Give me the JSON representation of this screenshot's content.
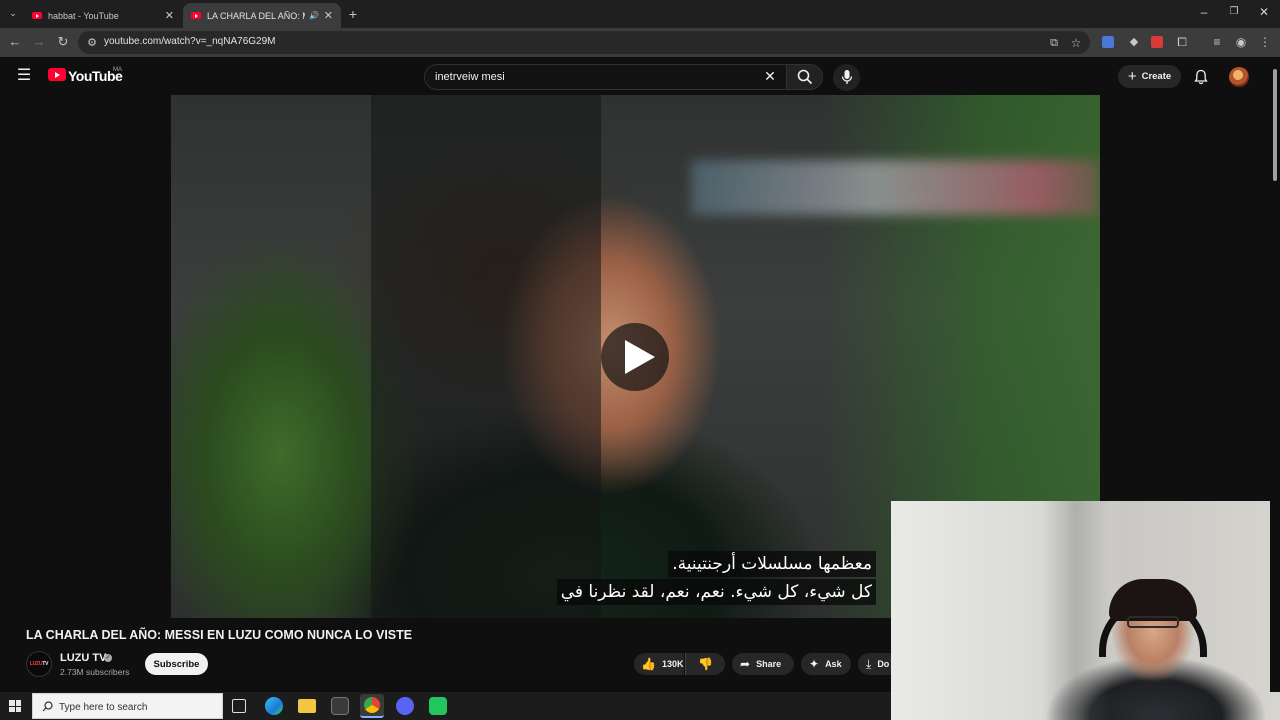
{
  "browser": {
    "tabs": [
      {
        "title": "habbat - YouTube"
      },
      {
        "title": "LA CHARLA DEL AÑO: MESS"
      }
    ],
    "url": "youtube.com/watch?v=_nqNA76G29M"
  },
  "youtube": {
    "logo_text": "YouTube",
    "country_code": "MA",
    "search_value": "inetrveiw mesi",
    "create_label": "Create"
  },
  "video": {
    "caption_line1": "معظمها مسلسلات أرجنتينية.",
    "caption_line2": "كل شيء، كل شيء. نعم، نعم، لقد نظرنا في",
    "title": "LA CHARLA DEL AÑO: MESSI EN LUZU COMO NUNCA LO VISTE"
  },
  "channel": {
    "name": "LUZU TV",
    "subscribers": "2.73M subscribers",
    "subscribe_label": "Subscribe",
    "avatar_text_a": "LUZU",
    "avatar_text_b": "TV"
  },
  "actions": {
    "likes": "130K",
    "share_label": "Share",
    "ask_label": "Ask",
    "download_label": "Do"
  },
  "taskbar": {
    "search_placeholder": "Type here to search"
  },
  "colors": {
    "youtube_red": "#ff0033",
    "background": "#0f0f0f",
    "chrome_toolbar": "#3c3c3c"
  }
}
